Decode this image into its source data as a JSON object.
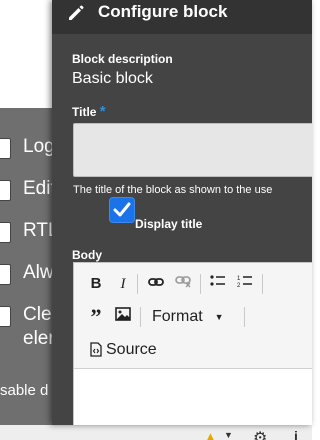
{
  "background_page": {
    "items": [
      {
        "label": "Log"
      },
      {
        "label": "Edit"
      },
      {
        "label": "RTL"
      },
      {
        "label": "Alw"
      },
      {
        "label": "Cle"
      },
      {
        "label": "eler"
      }
    ],
    "footer_text": "sable d"
  },
  "dialog": {
    "title": "Configure block",
    "block_description_label": "Block description",
    "block_description_value": "Basic block",
    "title_label": "Title",
    "required_marker": "*",
    "title_input_value": "",
    "title_description": "The title of the block as shown to the use",
    "display_title_label": "Display title",
    "display_title_checked": true,
    "body_label": "Body"
  },
  "editor": {
    "format_label": "Format",
    "source_label": "Source",
    "icons": [
      "bold-icon",
      "italic-icon",
      "link-icon",
      "unlink-icon",
      "bulleted-list-icon",
      "numbered-list-icon",
      "blockquote-icon",
      "image-icon",
      "source-icon"
    ]
  },
  "colors": {
    "offcanvas_bg": "#444444",
    "header_bg": "#333333",
    "checkbox_accent": "#1a73e8",
    "required": "#2f8fd8",
    "warning": "#e6a700"
  }
}
